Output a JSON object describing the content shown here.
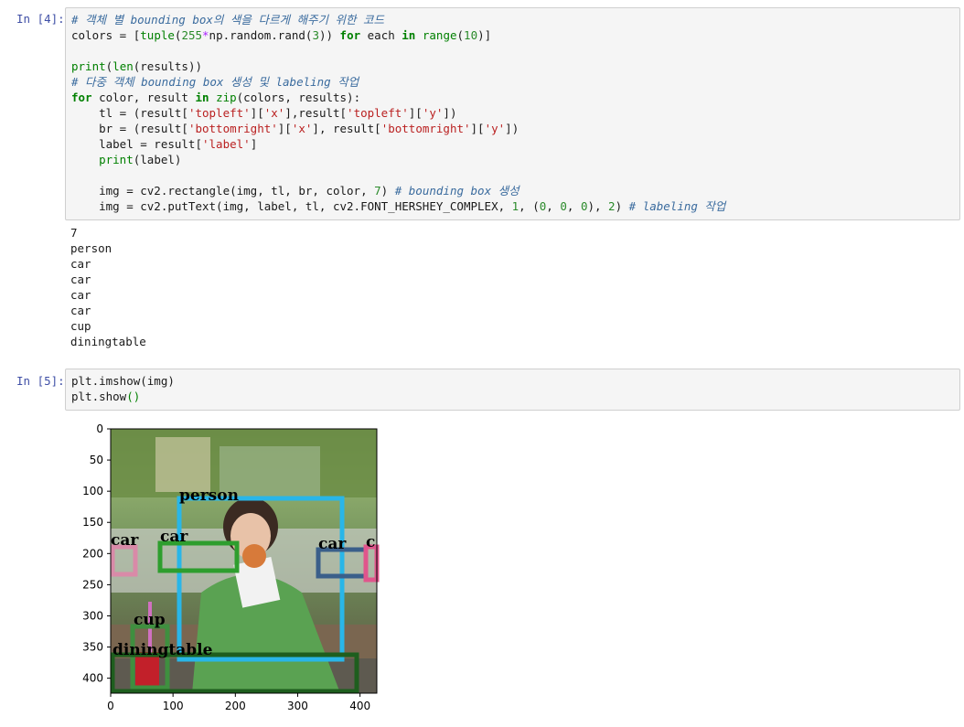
{
  "cells": [
    {
      "prompt": "In [4]:",
      "code_lines": [
        [
          {
            "t": "# 객체 별 bounding box의 색을 다르게 해주기 위한 코드",
            "c": "cm"
          }
        ],
        [
          {
            "t": "colors = [",
            "c": "pn"
          },
          {
            "t": "tuple",
            "c": "bi"
          },
          {
            "t": "(",
            "c": "pn"
          },
          {
            "t": "255",
            "c": "num"
          },
          {
            "t": "*",
            "c": "op"
          },
          {
            "t": "np.random.rand(",
            "c": "pn"
          },
          {
            "t": "3",
            "c": "num"
          },
          {
            "t": ")) ",
            "c": "pn"
          },
          {
            "t": "for",
            "c": "kw"
          },
          {
            "t": " each ",
            "c": "pn"
          },
          {
            "t": "in",
            "c": "kw"
          },
          {
            "t": " ",
            "c": "pn"
          },
          {
            "t": "range",
            "c": "bi"
          },
          {
            "t": "(",
            "c": "pn"
          },
          {
            "t": "10",
            "c": "num"
          },
          {
            "t": ")]",
            "c": "pn"
          }
        ],
        [],
        [
          {
            "t": "print",
            "c": "bi"
          },
          {
            "t": "(",
            "c": "pn"
          },
          {
            "t": "len",
            "c": "bi"
          },
          {
            "t": "(results))",
            "c": "pn"
          }
        ],
        [
          {
            "t": "# 다중 객체 bounding box 생성 및 labeling 작업",
            "c": "cm"
          }
        ],
        [
          {
            "t": "for",
            "c": "kw"
          },
          {
            "t": " color, result ",
            "c": "pn"
          },
          {
            "t": "in",
            "c": "kw"
          },
          {
            "t": " ",
            "c": "pn"
          },
          {
            "t": "zip",
            "c": "bi"
          },
          {
            "t": "(colors, results):",
            "c": "pn"
          }
        ],
        [
          {
            "t": "    tl = (result[",
            "c": "pn"
          },
          {
            "t": "'topleft'",
            "c": "str"
          },
          {
            "t": "][",
            "c": "pn"
          },
          {
            "t": "'x'",
            "c": "str"
          },
          {
            "t": "],result[",
            "c": "pn"
          },
          {
            "t": "'topleft'",
            "c": "str"
          },
          {
            "t": "][",
            "c": "pn"
          },
          {
            "t": "'y'",
            "c": "str"
          },
          {
            "t": "])",
            "c": "pn"
          }
        ],
        [
          {
            "t": "    br = (result[",
            "c": "pn"
          },
          {
            "t": "'bottomright'",
            "c": "str"
          },
          {
            "t": "][",
            "c": "pn"
          },
          {
            "t": "'x'",
            "c": "str"
          },
          {
            "t": "], result[",
            "c": "pn"
          },
          {
            "t": "'bottomright'",
            "c": "str"
          },
          {
            "t": "][",
            "c": "pn"
          },
          {
            "t": "'y'",
            "c": "str"
          },
          {
            "t": "])",
            "c": "pn"
          }
        ],
        [
          {
            "t": "    label = result[",
            "c": "pn"
          },
          {
            "t": "'label'",
            "c": "str"
          },
          {
            "t": "]",
            "c": "pn"
          }
        ],
        [
          {
            "t": "    ",
            "c": "pn"
          },
          {
            "t": "print",
            "c": "bi"
          },
          {
            "t": "(label)",
            "c": "pn"
          }
        ],
        [],
        [
          {
            "t": "    img = cv2.rectangle(img, tl, br, color, ",
            "c": "pn"
          },
          {
            "t": "7",
            "c": "num"
          },
          {
            "t": ") ",
            "c": "pn"
          },
          {
            "t": "# bounding box 생성",
            "c": "cm"
          }
        ],
        [
          {
            "t": "    img = cv2.putText(img, label, tl, cv2.FONT_HERSHEY_COMPLEX, ",
            "c": "pn"
          },
          {
            "t": "1",
            "c": "num"
          },
          {
            "t": ", (",
            "c": "pn"
          },
          {
            "t": "0",
            "c": "num"
          },
          {
            "t": ", ",
            "c": "pn"
          },
          {
            "t": "0",
            "c": "num"
          },
          {
            "t": ", ",
            "c": "pn"
          },
          {
            "t": "0",
            "c": "num"
          },
          {
            "t": "), ",
            "c": "pn"
          },
          {
            "t": "2",
            "c": "num"
          },
          {
            "t": ") ",
            "c": "pn"
          },
          {
            "t": "# labeling 작업",
            "c": "cm"
          }
        ]
      ],
      "output_lines": [
        "7",
        "person",
        "car",
        "car",
        "car",
        "car",
        "cup",
        "diningtable"
      ]
    },
    {
      "prompt": "In [5]:",
      "code_lines": [
        [
          {
            "t": "plt.imshow(img)",
            "c": "pn"
          }
        ],
        [
          {
            "t": "plt.show",
            "c": "pn"
          },
          {
            "t": "()",
            "c": "bi"
          }
        ]
      ]
    }
  ],
  "figure": {
    "y_ticks": [
      "0",
      "50",
      "100",
      "150",
      "200",
      "250",
      "300",
      "350",
      "400"
    ],
    "x_ticks": [
      "0",
      "100",
      "200",
      "300",
      "400"
    ],
    "detections": [
      {
        "label": "person",
        "color": "#29b6e8"
      },
      {
        "label": "car",
        "color": "#d98aa8"
      },
      {
        "label": "car",
        "color": "#2e9e2e"
      },
      {
        "label": "car",
        "color": "#3a5f8a"
      },
      {
        "label": "car",
        "color": "#e0558c"
      },
      {
        "label": "cup",
        "color": "#3f8f3f"
      },
      {
        "label": "diningtable",
        "color": "#1e5e1e"
      }
    ],
    "box_label_texts": [
      "person",
      "car",
      "car",
      "car",
      "c",
      "cup",
      "diningtable"
    ]
  }
}
